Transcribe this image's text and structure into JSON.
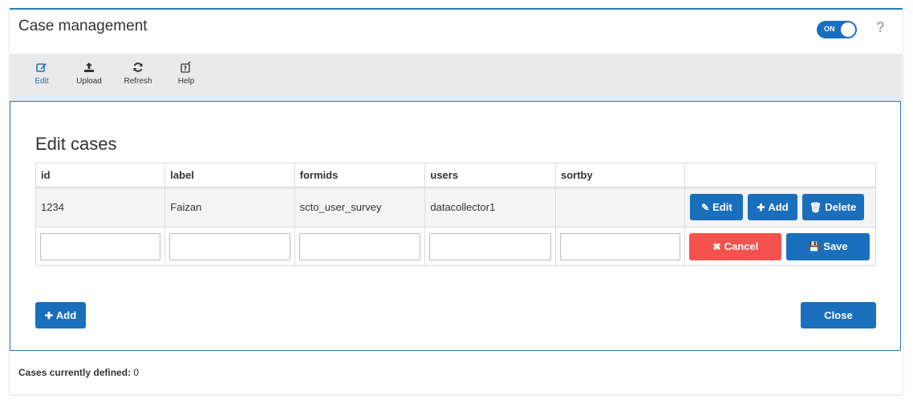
{
  "header": {
    "title": "Case management",
    "toggle_label": "ON",
    "help_label": "?"
  },
  "toolbar": {
    "items": [
      {
        "label": "Edit"
      },
      {
        "label": "Upload"
      },
      {
        "label": "Refresh"
      },
      {
        "label": "Help"
      }
    ]
  },
  "panel": {
    "title": "Edit cases"
  },
  "table": {
    "columns": [
      "id",
      "label",
      "formids",
      "users",
      "sortby"
    ],
    "rows": [
      {
        "id": "1234",
        "label": "Faizan",
        "formids": "scto_user_survey",
        "users": "datacollector1",
        "sortby": ""
      }
    ],
    "row_actions": {
      "edit": "Edit",
      "add": "Add",
      "delete": "Delete"
    },
    "edit_actions": {
      "cancel": "Cancel",
      "save": "Save"
    }
  },
  "buttons": {
    "add": "Add",
    "close": "Close"
  },
  "footer": {
    "label": "Cases currently defined:",
    "count": "0"
  },
  "colors": {
    "primary": "#1a6fbd",
    "danger": "#f5524d",
    "toolbar_bg": "#eaeaea"
  }
}
